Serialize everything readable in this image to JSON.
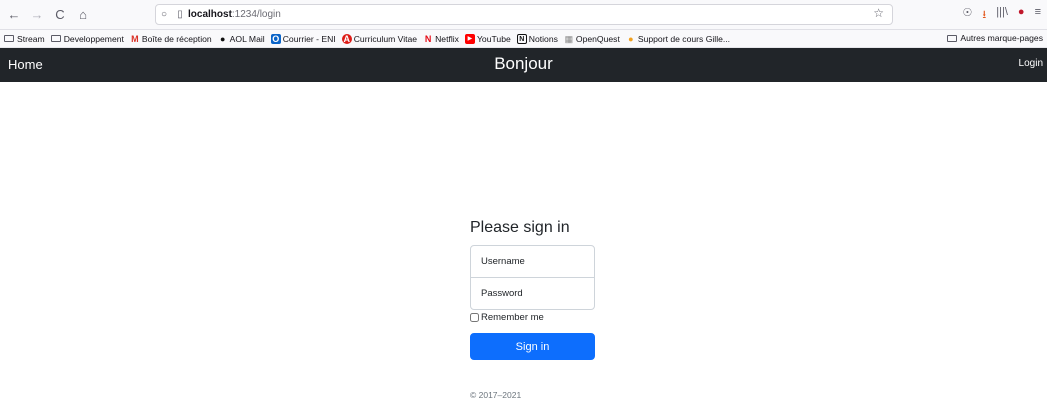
{
  "browser": {
    "nav": {
      "back": "←",
      "forward": "→",
      "reload": "C",
      "home": "⌂"
    },
    "url_host": "localhost",
    "url_path": ":1234/login",
    "tools": {
      "pocket": "☉",
      "download": "⭳",
      "library": "|||\\",
      "extension": "●",
      "menu": "≡"
    },
    "bookmarks": [
      {
        "label": "Stream",
        "icon": "folder"
      },
      {
        "label": "Developpement",
        "icon": "folder"
      },
      {
        "label": "Boîte de réception",
        "icon": "M",
        "color": "#d93025"
      },
      {
        "label": "AOL Mail",
        "icon": "●",
        "color": "#111111"
      },
      {
        "label": "Courrier - ENI",
        "icon": "O",
        "color": "#0a64c8"
      },
      {
        "label": "Curriculum Vitae",
        "icon": "A",
        "color": "#dd1b16"
      },
      {
        "label": "Netflix",
        "icon": "N",
        "color": "#e50914"
      },
      {
        "label": "YouTube",
        "icon": "▶",
        "color": "#ff0000"
      },
      {
        "label": "Notions",
        "icon": "N",
        "color": "#111111"
      },
      {
        "label": "OpenQuest",
        "icon": "▦",
        "color": "#888888"
      },
      {
        "label": "Support de cours Gille...",
        "icon": "●",
        "color": "#f0a020"
      }
    ],
    "other_bookmarks": "Autres marque-pages"
  },
  "navbar": {
    "home": "Home",
    "brand": "Bonjour",
    "login": "Login"
  },
  "form": {
    "heading": "Please sign in",
    "username_placeholder": "Username",
    "password_placeholder": "Password",
    "remember": "Remember me",
    "submit": "Sign in"
  },
  "footer": {
    "copyright": "© 2017–2021"
  }
}
